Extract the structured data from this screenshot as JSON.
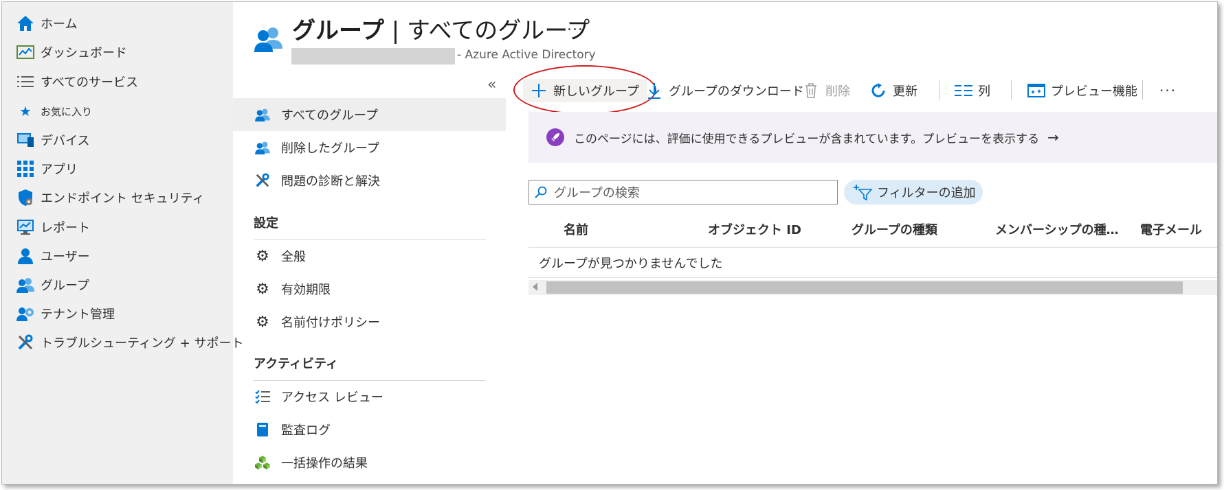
{
  "left_nav": {
    "items": [
      {
        "label": "ホーム",
        "icon": "home-icon"
      },
      {
        "label": "ダッシュボード",
        "icon": "dashboard-icon"
      },
      {
        "label": "すべてのサービス",
        "icon": "list-icon"
      },
      {
        "label": "お気に入り",
        "icon": "star-icon"
      },
      {
        "label": "デバイス",
        "icon": "devices-icon"
      },
      {
        "label": "アプリ",
        "icon": "apps-grid-icon"
      },
      {
        "label": "エンドポイント セキュリティ",
        "icon": "shield-icon"
      },
      {
        "label": "レポート",
        "icon": "monitor-report-icon"
      },
      {
        "label": "ユーザー",
        "icon": "user-icon"
      },
      {
        "label": "グループ",
        "icon": "group-icon"
      },
      {
        "label": "テナント管理",
        "icon": "tenant-gear-icon"
      },
      {
        "label": "トラブルシューティング + サポート",
        "icon": "tools-icon"
      }
    ]
  },
  "header": {
    "title_bold": "グループ",
    "title_rest": " | すべてのグループ",
    "more": "...",
    "subtitle": "- Azure Active Directory"
  },
  "blade_menu": {
    "collapse": "«",
    "items": [
      {
        "label": "すべてのグループ",
        "icon": "group-icon",
        "active": true
      },
      {
        "label": "削除したグループ",
        "icon": "group-icon"
      },
      {
        "label": "問題の診断と解決",
        "icon": "tools-icon"
      }
    ],
    "settings_heading": "設定",
    "settings_items": [
      {
        "label": "全般",
        "icon": "gear-icon"
      },
      {
        "label": "有効期限",
        "icon": "gear-icon"
      },
      {
        "label": "名前付けポリシー",
        "icon": "gear-icon"
      }
    ],
    "activity_heading": "アクティビティ",
    "activity_items": [
      {
        "label": "アクセス レビュー",
        "icon": "checklist-icon"
      },
      {
        "label": "監査ログ",
        "icon": "book-icon"
      },
      {
        "label": "一括操作の結果",
        "icon": "cubes-icon"
      }
    ]
  },
  "toolbar": {
    "new_group": "新しいグループ",
    "download": "グループのダウンロード",
    "delete": "削除",
    "refresh": "更新",
    "columns": "列",
    "preview": "プレビュー機能",
    "more": "···"
  },
  "banner": {
    "text": "このページには、評価に使用できるプレビューが含まれています。プレビューを表示する",
    "arrow": "→"
  },
  "search": {
    "placeholder": "グループの検索"
  },
  "filter": {
    "label": "フィルターの追加"
  },
  "table": {
    "columns": [
      "名前",
      "オブジェクト ID",
      "グループの種類",
      "メンバーシップの種…",
      "電子メール"
    ],
    "empty_message": "グループが見つかりませんでした"
  },
  "colors": {
    "accent": "#0078d4",
    "highlight": "#d11b1b",
    "banner_bg": "#f3f0f7",
    "nav_bg": "#f0f0f0"
  }
}
